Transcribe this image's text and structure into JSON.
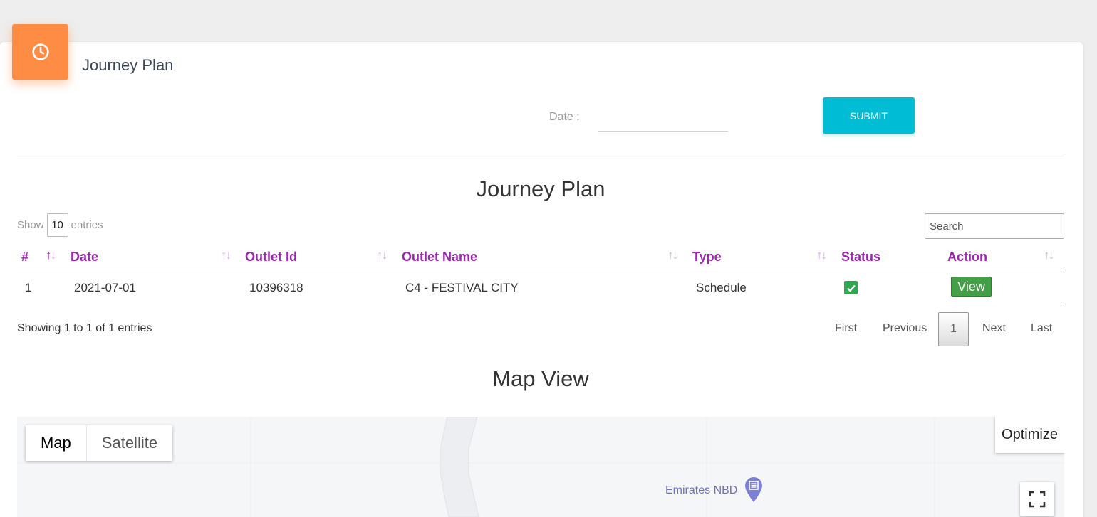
{
  "card": {
    "title": "Journey Plan",
    "icon": "clock-icon",
    "icon_color": "#ff8c45"
  },
  "filter": {
    "date_label": "Date :",
    "date_value": "",
    "submit_label": "SUBMIT",
    "submit_color": "#00bcd4"
  },
  "table_section": {
    "title": "Journey Plan",
    "show_label": "Show",
    "entries_value": "10",
    "entries_label": "entries",
    "search_placeholder": "Search",
    "columns": [
      "#",
      "Date",
      "Outlet Id",
      "Outlet Name",
      "Type",
      "Status",
      "Action"
    ],
    "header_color": "#9c27b0",
    "rows": [
      {
        "index": "1",
        "date": "2021-07-01",
        "outlet_id": "10396318",
        "outlet_name": "C4 - FESTIVAL CITY",
        "type": "Schedule",
        "status": "checked",
        "action": "View"
      }
    ],
    "info": "Showing 1 to 1 of 1 entries",
    "pagination": {
      "first": "First",
      "previous": "Previous",
      "current": "1",
      "next": "Next",
      "last": "Last"
    }
  },
  "map_section": {
    "title": "Map View",
    "map_type_map": "Map",
    "map_type_satellite": "Satellite",
    "optimize_label": "Optimize",
    "poi_label": "Emirates NBD",
    "poi_icon": "bank-icon",
    "fullscreen_icon": "fullscreen-icon"
  }
}
